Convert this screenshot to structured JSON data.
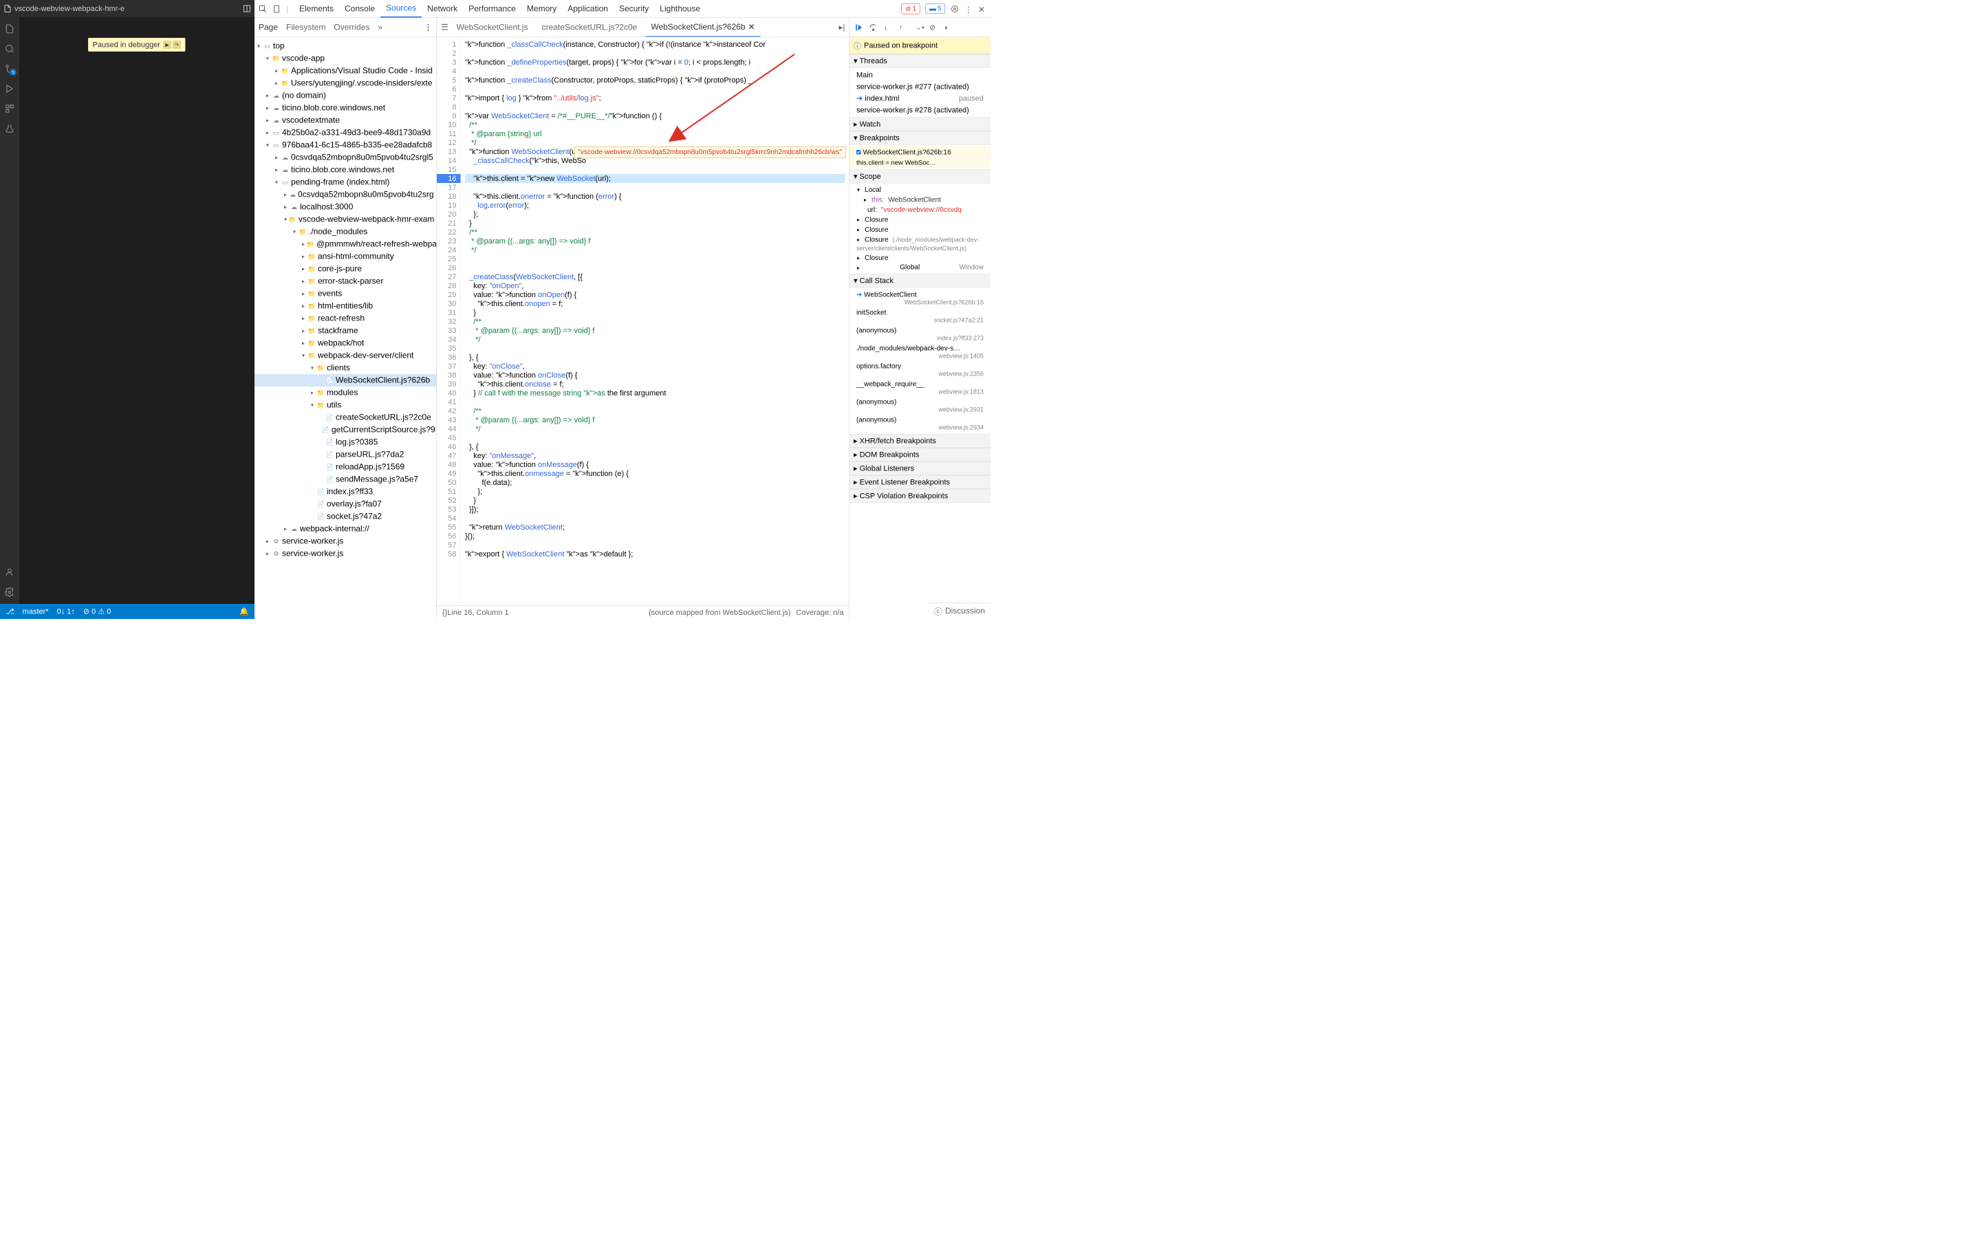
{
  "vscode": {
    "title": "vscode-webview-webpack-hmr-e",
    "paused_banner": "Paused in debugger",
    "status": {
      "branch": "master*",
      "sync": "0↓ 1↑",
      "problems": "0  0"
    },
    "activity_badge": "5"
  },
  "devtools": {
    "tabs": [
      "Elements",
      "Console",
      "Sources",
      "Network",
      "Performance",
      "Memory",
      "Application",
      "Security",
      "Lighthouse"
    ],
    "active_tab": "Sources",
    "errors": "1",
    "issues": "5"
  },
  "sources_subtabs": [
    "Page",
    "Filesystem",
    "Overrides"
  ],
  "file_tree": [
    {
      "d": 0,
      "t": "frame",
      "l": "top",
      "e": true
    },
    {
      "d": 1,
      "t": "folder-b",
      "l": "vscode-app",
      "e": true
    },
    {
      "d": 2,
      "t": "folder-b",
      "l": "Applications/Visual Studio Code - Insid",
      "e": false
    },
    {
      "d": 2,
      "t": "folder-b",
      "l": "Users/yutengjing/.vscode-insiders/exte",
      "e": false
    },
    {
      "d": 1,
      "t": "cloud",
      "l": "(no domain)",
      "e": false
    },
    {
      "d": 1,
      "t": "cloud",
      "l": "ticino.blob.core.windows.net",
      "e": false
    },
    {
      "d": 1,
      "t": "cloud",
      "l": "vscodetextmate",
      "e": false
    },
    {
      "d": 1,
      "t": "frame",
      "l": "4b25b0a2-a331-49d3-bee9-48d1730a9d",
      "e": false
    },
    {
      "d": 1,
      "t": "frame",
      "l": "976baa41-6c15-4865-b335-ee28adafcb8",
      "e": true
    },
    {
      "d": 2,
      "t": "cloud",
      "l": "0csvdqa52mbopn8u0m5pvob4tu2srgl5",
      "e": false
    },
    {
      "d": 2,
      "t": "cloud",
      "l": "ticino.blob.core.windows.net",
      "e": false
    },
    {
      "d": 2,
      "t": "frame",
      "l": "pending-frame (index.html)",
      "e": true
    },
    {
      "d": 3,
      "t": "cloud",
      "l": "0csvdqa52mbopn8u0m5pvob4tu2srg",
      "e": false
    },
    {
      "d": 3,
      "t": "cloud",
      "l": "localhost:3000",
      "e": false
    },
    {
      "d": 3,
      "t": "folder",
      "l": "vscode-webview-webpack-hmr-exam",
      "e": true
    },
    {
      "d": 4,
      "t": "folder",
      "l": "./node_modules",
      "e": true
    },
    {
      "d": 5,
      "t": "folder",
      "l": "@pmmmwh/react-refresh-webpa",
      "e": false
    },
    {
      "d": 5,
      "t": "folder",
      "l": "ansi-html-community",
      "e": false
    },
    {
      "d": 5,
      "t": "folder",
      "l": "core-js-pure",
      "e": false
    },
    {
      "d": 5,
      "t": "folder",
      "l": "error-stack-parser",
      "e": false
    },
    {
      "d": 5,
      "t": "folder",
      "l": "events",
      "e": false
    },
    {
      "d": 5,
      "t": "folder",
      "l": "html-entities/lib",
      "e": false
    },
    {
      "d": 5,
      "t": "folder",
      "l": "react-refresh",
      "e": false
    },
    {
      "d": 5,
      "t": "folder",
      "l": "stackframe",
      "e": false
    },
    {
      "d": 5,
      "t": "folder",
      "l": "webpack/hot",
      "e": false
    },
    {
      "d": 5,
      "t": "folder",
      "l": "webpack-dev-server/client",
      "e": true
    },
    {
      "d": 6,
      "t": "folder",
      "l": "clients",
      "e": true
    },
    {
      "d": 7,
      "t": "file",
      "l": "WebSocketClient.js?626b",
      "sel": true
    },
    {
      "d": 6,
      "t": "folder",
      "l": "modules",
      "e": false
    },
    {
      "d": 6,
      "t": "folder",
      "l": "utils",
      "e": true
    },
    {
      "d": 7,
      "t": "file",
      "l": "createSocketURL.js?2c0e"
    },
    {
      "d": 7,
      "t": "file",
      "l": "getCurrentScriptSource.js?9"
    },
    {
      "d": 7,
      "t": "file",
      "l": "log.js?0385"
    },
    {
      "d": 7,
      "t": "file",
      "l": "parseURL.js?7da2"
    },
    {
      "d": 7,
      "t": "file",
      "l": "reloadApp.js?1569"
    },
    {
      "d": 7,
      "t": "file",
      "l": "sendMessage.js?a5e7"
    },
    {
      "d": 6,
      "t": "file",
      "l": "index.js?ff33"
    },
    {
      "d": 6,
      "t": "file",
      "l": "overlay.js?fa07"
    },
    {
      "d": 6,
      "t": "file",
      "l": "socket.js?47a2"
    },
    {
      "d": 3,
      "t": "cloud",
      "l": "webpack-internal://",
      "e": false
    },
    {
      "d": 1,
      "t": "gear",
      "l": "service-worker.js",
      "e": false
    },
    {
      "d": 1,
      "t": "gear",
      "l": "service-worker.js",
      "e": false
    }
  ],
  "editor": {
    "tabs": [
      "WebSocketClient.js",
      "createSocketURL.js?2c0e",
      "WebSocketClient.js?626b"
    ],
    "active": 2,
    "breakpoint_line": 16,
    "tooltip": "\"vscode-webview://0csvdqa52mbopn8u0m5pvob4tu2srgl5krrc9nh2mdcafmhh26cb/ws\"",
    "footer": {
      "pos": "Line 16, Column 1",
      "map": "(source mapped from WebSocketClient.js)",
      "cov": "Coverage: n/a"
    }
  },
  "code_lines": [
    "function _classCallCheck(instance, Constructor) { if (!(instance instanceof Cor",
    "",
    "function _defineProperties(target, props) { for (var i = 0; i < props.length; i",
    "",
    "function _createClass(Constructor, protoProps, staticProps) { if (protoProps) _",
    "",
    "import { log } from \"../utils/log.js\";",
    "",
    "var WebSocketClient = /*#__PURE__*/function () {",
    "  /**",
    "   * @param {string} url",
    "   */",
    "  function WebSocketClient(url) {",
    "    _classCallCheck(this, WebSo",
    "",
    "    this.client = new WebSocket(url);",
    "",
    "    this.client.onerror = function (error) {",
    "      log.error(error);",
    "    };",
    "  }",
    "  /**",
    "   * @param {(...args: any[]) => void} f",
    "   */",
    "",
    "",
    "  _createClass(WebSocketClient, [{",
    "    key: \"onOpen\",",
    "    value: function onOpen(f) {",
    "      this.client.onopen = f;",
    "    }",
    "    /**",
    "     * @param {(...args: any[]) => void} f",
    "     */",
    "",
    "  }, {",
    "    key: \"onClose\",",
    "    value: function onClose(f) {",
    "      this.client.onclose = f;",
    "    } // call f with the message string as the first argument",
    "",
    "    /**",
    "     * @param {(...args: any[]) => void} f",
    "     */",
    "",
    "  }, {",
    "    key: \"onMessage\",",
    "    value: function onMessage(f) {",
    "      this.client.onmessage = function (e) {",
    "        f(e.data);",
    "      };",
    "    }",
    "  }]);",
    "",
    "  return WebSocketClient;",
    "}();",
    "",
    "export { WebSocketClient as default };"
  ],
  "debugger": {
    "paused_label": "Paused on breakpoint",
    "threads": {
      "title": "Threads",
      "items": [
        {
          "name": "Main",
          "status": ""
        },
        {
          "name": "service-worker.js #277 (activated)",
          "status": ""
        },
        {
          "name": "index.html",
          "status": "paused",
          "icon": true
        },
        {
          "name": "service-worker.js #278 (activated)",
          "status": ""
        }
      ]
    },
    "watch": "Watch",
    "breakpoints": {
      "title": "Breakpoints",
      "item_file": "WebSocketClient.js?626b:16",
      "item_code": "this.client = new WebSoc…"
    },
    "scope": {
      "title": "Scope",
      "local": "Local",
      "this_lbl": "this:",
      "this_val": "WebSocketClient",
      "url_lbl": "url:",
      "url_val": "\"vscode-webview://0csvdq",
      "closures": [
        "Closure",
        "Closure",
        "Closure",
        "(./node_modules/webpack-dev-server/client/clients/WebSocketClient.js)",
        "Closure"
      ],
      "global": "Global",
      "global_val": "Window"
    },
    "callstack": {
      "title": "Call Stack",
      "items": [
        {
          "name": "WebSocketClient",
          "loc": "WebSocketClient.js?626b:16",
          "active": true
        },
        {
          "name": "initSocket",
          "loc": "socket.js?47a2:21"
        },
        {
          "name": "(anonymous)",
          "loc": "index.js?ff33:273"
        },
        {
          "name": "./node_modules/webpack-dev-s…",
          "loc": "webview.js:1405"
        },
        {
          "name": "options.factory",
          "loc": "webview.js:2356"
        },
        {
          "name": "__webpack_require__",
          "loc": "webview.js:1813"
        },
        {
          "name": "(anonymous)",
          "loc": "webview.js:2931"
        },
        {
          "name": "(anonymous)",
          "loc": "webview.js:2934"
        }
      ]
    },
    "other_sections": [
      "XHR/fetch Breakpoints",
      "DOM Breakpoints",
      "Global Listeners",
      "Event Listener Breakpoints",
      "CSP Violation Breakpoints"
    ]
  },
  "discussion": "Discussion"
}
